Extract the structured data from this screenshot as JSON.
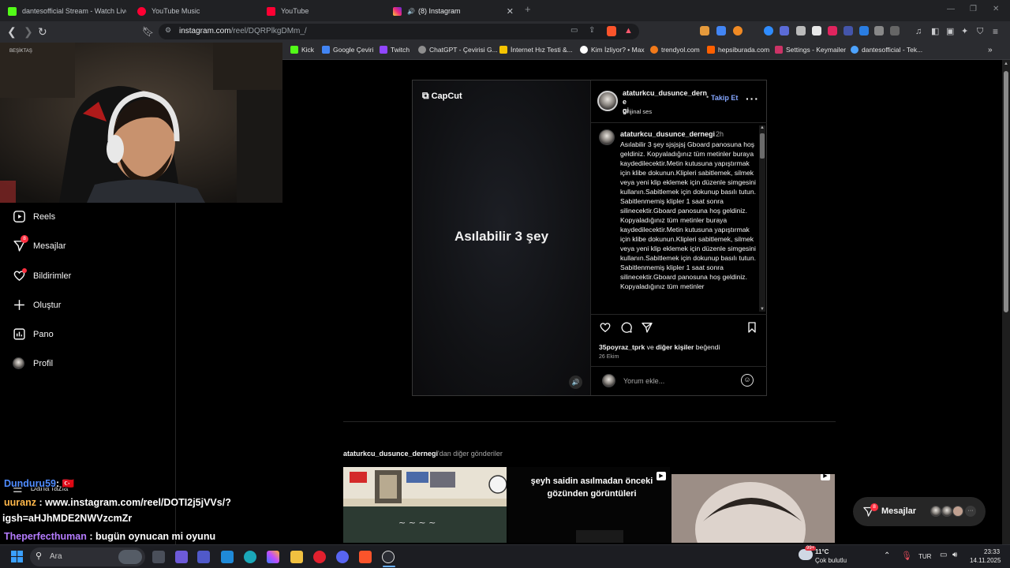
{
  "browser": {
    "tabs": [
      {
        "title": "dantesofficial Stream - Watch Live",
        "color": "#53fc18"
      },
      {
        "title": "YouTube Music",
        "color": "#ff0033"
      },
      {
        "title": "YouTube",
        "color": "#ff0033"
      },
      {
        "title": "(8) Instagram",
        "color": "#e1306c"
      }
    ],
    "url_host": "instagram.com",
    "url_path": "/reel/DQRPlkgDMm_/",
    "bookmarks": [
      {
        "label": "Kick",
        "color": "#53fc18"
      },
      {
        "label": "Google Çeviri",
        "color": "#4285f4"
      },
      {
        "label": "Twitch",
        "color": "#9146ff"
      },
      {
        "label": "ChatGPT - Çevirisi G...",
        "color": "#8e8e8e"
      },
      {
        "label": "İnternet Hız Testi &...",
        "color": "#f5c400"
      },
      {
        "label": "Kim İzliyor? • Max",
        "color": "#ffffff"
      },
      {
        "label": "trendyol.com",
        "color": "#f27a1a"
      },
      {
        "label": "hepsiburada.com",
        "color": "#ff6000"
      },
      {
        "label": "Settings - Keymailer",
        "color": "#cc3366"
      },
      {
        "label": "dantesofficial - Tek...",
        "color": "#4da3ff"
      }
    ]
  },
  "sidebar": {
    "items": [
      {
        "label": "Reels"
      },
      {
        "label": "Mesajlar",
        "badge": "8"
      },
      {
        "label": "Bildirimler"
      },
      {
        "label": "Oluştur"
      },
      {
        "label": "Pano"
      },
      {
        "label": "Profil"
      }
    ],
    "more_label": "Daha fazla"
  },
  "post": {
    "brand": "CapCut",
    "video_text": "Asılabilir 3 şey",
    "username_line1": "ataturkcu_dusunce_derne",
    "username_line2": "gi",
    "follow": "Takip Et",
    "audio": "Orijinal ses",
    "caption_user": "ataturkcu_dusunce_dernegi",
    "caption_time": "2h",
    "caption_text": "Asılabilir 3 şey sjsjsjsj Gboard panosuna hoş geldiniz. Kopyaladığınız tüm metinler buraya kaydedilecektir.Metin kutusuna yapıştırmak için klibe dokunun.Klipleri sabitlemek, silmek veya yeni klip eklemek için düzenle simgesini kullanın.Sabitlemek için dokunup basılı tutun. Sabitlenmemiş klipler 1 saat sonra silinecektir.Gboard panosuna hoş geldiniz. Kopyaladığınız tüm metinler buraya kaydedilecektir.Metin kutusuna yapıştırmak için klibe dokunun.Klipleri sabitlemek, silmek veya yeni klip eklemek için düzenle simgesini kullanın.Sabitlemek için dokunup basılı tutun. Sabitlenmemiş klipler 1 saat sonra silinecektir.Gboard panosuna hoş geldiniz. Kopyaladığınız tüm metinler",
    "likes_user": "35poyraz_tprk",
    "likes_mid": "ve",
    "likes_others": "diğer kişiler",
    "likes_end": "beğendi",
    "date": "26 Ekim",
    "comment_placeholder": "Yorum ekle..."
  },
  "more_posts": {
    "user": "ataturkcu_dusunce_dernegi",
    "suffix": "'dan diğer gönderiler",
    "thumb2_text": "şeyh saidin asılmadan önceki gözünden görüntüleri"
  },
  "messages_pill": {
    "label": "Mesajlar",
    "badge": "8"
  },
  "chat": [
    {
      "user": "Dunduru59",
      "user_color": "#4f8cff",
      "text": ": 🇹🇷"
    },
    {
      "user": "uuranz",
      "user_color": "#ffb84a",
      "text": ": www.instagram.com/reel/DOTI2j5jVVs/?"
    },
    {
      "user": "",
      "user_color": "#ffffff",
      "text": "igsh=aHJhMDE2NWVzcmZr"
    },
    {
      "user": "Theperfecthuman",
      "user_color": "#b57cff",
      "text": ": bugün oynucan mi oyunu"
    }
  ],
  "taskbar": {
    "search_placeholder": "Ara",
    "weather_temp": "11°C",
    "weather_desc": "Çok bulutlu",
    "lang": "TUR",
    "time": "23:33",
    "date": "14.11.2025",
    "weather_badge": "99+"
  }
}
